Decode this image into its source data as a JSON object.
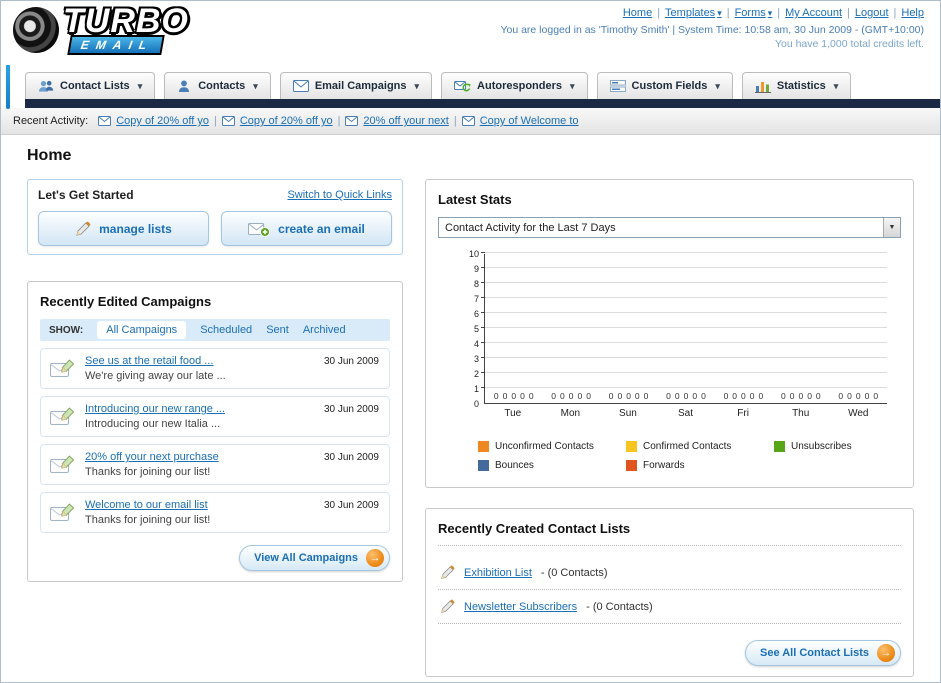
{
  "colors": {
    "link_blue": "#1b6fb5",
    "navy_bar": "#1b2944",
    "orange_arrow": "#ef8c1a"
  },
  "header": {
    "logo_title": "TURBO",
    "logo_subtitle": "EMAIL",
    "nav_links": [
      {
        "label": "Home",
        "dropdown": false
      },
      {
        "label": "Templates",
        "dropdown": true
      },
      {
        "label": "Forms",
        "dropdown": true
      },
      {
        "label": "My Account",
        "dropdown": false
      },
      {
        "label": "Logout",
        "dropdown": false
      },
      {
        "label": "Help",
        "dropdown": false
      }
    ],
    "login_info": "You are logged in as 'Timothy Smith' | System Time: 10:58 am, 30 Jun 2009 - (GMT+10:00)",
    "credits_info": "You have 1,000 total credits left."
  },
  "main_nav": {
    "tabs": [
      {
        "label": "Contact Lists",
        "icon": "contact-lists-icon"
      },
      {
        "label": "Contacts",
        "icon": "contacts-icon"
      },
      {
        "label": "Email Campaigns",
        "icon": "email-campaigns-icon"
      },
      {
        "label": "Autoresponders",
        "icon": "autoresponders-icon"
      },
      {
        "label": "Custom Fields",
        "icon": "custom-fields-icon"
      },
      {
        "label": "Statistics",
        "icon": "statistics-icon"
      }
    ]
  },
  "recent_activity": {
    "label": "Recent Activity:",
    "items": [
      "Copy of 20% off yo",
      "Copy of 20% off yo",
      "20% off your next",
      "Copy of Welcome to"
    ]
  },
  "page": {
    "title": "Home"
  },
  "get_started": {
    "title": "Let's Get Started",
    "switch_link": "Switch to Quick Links",
    "buttons": [
      {
        "label": "manage lists"
      },
      {
        "label": "create an email"
      }
    ]
  },
  "campaigns": {
    "title": "Recently Edited Campaigns",
    "show_label": "SHOW:",
    "tabs": [
      "All Campaigns",
      "Scheduled",
      "Sent",
      "Archived"
    ],
    "active_tab": "All Campaigns",
    "items": [
      {
        "title": "See us at the retail food ...",
        "subtitle": "We're giving away our late ...",
        "date": "30 Jun 2009"
      },
      {
        "title": "Introducing our new range ...",
        "subtitle": "Introducing our new Italia ...",
        "date": "30 Jun 2009"
      },
      {
        "title": "20% off your next purchase",
        "subtitle": "Thanks for joining our list!",
        "date": "30 Jun 2009"
      },
      {
        "title": "Welcome to our email list",
        "subtitle": "Thanks for joining our list!",
        "date": "30 Jun 2009"
      }
    ],
    "view_all_label": "View All Campaigns"
  },
  "stats": {
    "title": "Latest Stats",
    "dropdown_value": "Contact Activity for the Last 7 Days",
    "legend": [
      {
        "label": "Unconfirmed Contacts",
        "color": "#f08821"
      },
      {
        "label": "Confirmed Contacts",
        "color": "#f6c51f"
      },
      {
        "label": "Unsubscribes",
        "color": "#58a618"
      },
      {
        "label": "Bounces",
        "color": "#44699d"
      },
      {
        "label": "Forwards",
        "color": "#e2541e"
      }
    ]
  },
  "chart_data": {
    "type": "bar",
    "title": "Contact Activity for the Last 7 Days",
    "categories": [
      "Tue",
      "Mon",
      "Sun",
      "Sat",
      "Fri",
      "Thu",
      "Wed"
    ],
    "series": [
      {
        "name": "Unconfirmed Contacts",
        "color": "#f08821",
        "values": [
          0,
          0,
          0,
          0,
          0,
          0,
          0
        ]
      },
      {
        "name": "Confirmed Contacts",
        "color": "#f6c51f",
        "values": [
          0,
          0,
          0,
          0,
          0,
          0,
          0
        ]
      },
      {
        "name": "Unsubscribes",
        "color": "#58a618",
        "values": [
          0,
          0,
          0,
          0,
          0,
          0,
          0
        ]
      },
      {
        "name": "Bounces",
        "color": "#44699d",
        "values": [
          0,
          0,
          0,
          0,
          0,
          0,
          0
        ]
      },
      {
        "name": "Forwards",
        "color": "#e2541e",
        "values": [
          0,
          0,
          0,
          0,
          0,
          0,
          0
        ]
      }
    ],
    "xlabel": "",
    "ylabel": "",
    "ylim": [
      0,
      10
    ],
    "yticks": [
      0,
      1,
      2,
      3,
      4,
      5,
      6,
      7,
      8,
      9,
      10
    ],
    "grid": true,
    "legend_position": "bottom",
    "value_labels_shown": true
  },
  "contact_lists": {
    "title": "Recently Created Contact Lists",
    "items": [
      {
        "name": "Exhibition List",
        "suffix": " - (0 Contacts)"
      },
      {
        "name": "Newsletter Subscribers",
        "suffix": " - (0 Contacts)"
      }
    ],
    "see_all_label": "See All Contact Lists"
  }
}
